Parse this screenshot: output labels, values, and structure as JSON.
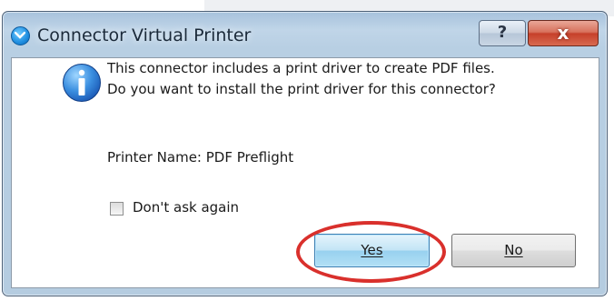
{
  "dialog": {
    "title": "Connector Virtual Printer",
    "help_label": "?",
    "close_label": "x",
    "message_line1": "This connector includes a print driver to create PDF files.",
    "message_line2": "Do you want to install the print driver for this connector?",
    "printer_name_text": "Printer Name: PDF Preflight",
    "checkbox": {
      "label": "Don't ask again",
      "checked": false
    },
    "yes_label": "Yes",
    "no_label": "No",
    "highlight_color": "#d9302c"
  }
}
